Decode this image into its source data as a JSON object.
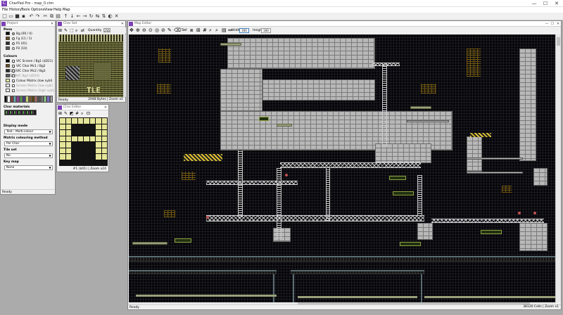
{
  "app": {
    "title": "CharPad Pro - map_0.ctm",
    "controls": [
      "—",
      "☐",
      "✕"
    ]
  },
  "menu": [
    "File",
    "History",
    "Tools",
    "Options",
    "View",
    "Help",
    "Map"
  ],
  "toolbar_icons": [
    "new-icon",
    "open-icon",
    "save-icon",
    "save-all-icon",
    "undo-icon",
    "redo-icon",
    "cut-icon",
    "copy-icon",
    "paste-icon",
    "shift-up-icon",
    "shift-down-icon",
    "shift-left-icon",
    "shift-right-icon",
    "rotate-icon",
    "mirror-icon",
    "flip-icon",
    "invert-icon",
    "clear-icon"
  ],
  "project": {
    "caption": "Project",
    "pens_title": "Pens",
    "pens": [
      {
        "label": "Bg (00 / 0)",
        "color": "#000000",
        "selected": true
      },
      {
        "label": "Fg (11 / 1)",
        "color": "#6b4a1a",
        "selected": false
      },
      {
        "label": "P1 (01)",
        "color": "#2a2a2a",
        "selected": false
      },
      {
        "label": "P2 (10)",
        "color": "#5a5a5a",
        "selected": false
      }
    ],
    "colours_title": "Colours",
    "colours": [
      {
        "label": "VIC Screen / Bg1 ($D21)",
        "color": "#000000",
        "checked": true
      },
      {
        "label": "VIC Char Mc1 / Bg2 ($D22)",
        "color": "#6b4a1a",
        "checked": true
      },
      {
        "label": "VIC Char Mc2 / Bg3 ($D23)",
        "color": "#2a2a2a",
        "checked": true
      },
      {
        "label": "VIC Bg4 ($D24)",
        "color": "#5a5a5a",
        "checked": false
      },
      {
        "label": "Colour Matrix (low nybl)",
        "color": "#e8e8a0",
        "checked": true
      },
      {
        "label": "Screen Matrix (low nybl)",
        "color": "#ffffff",
        "checked": false
      },
      {
        "label": "Screen Matrix (high nybl)",
        "color": "#ffffff",
        "checked": false
      }
    ],
    "palette": [
      "#000000",
      "#ffffff",
      "#883932",
      "#67b6bd",
      "#8b3f96",
      "#55a049",
      "#40318d",
      "#bfce72",
      "#8b5429",
      "#574200",
      "#b86962",
      "#505050",
      "#787878",
      "#94e089",
      "#7869c4",
      "#9f9f9f"
    ],
    "char_materials_title": "Char materials",
    "display_mode_label": "Display mode",
    "display_mode": "Text - Multi-colour",
    "matrix_label": "Matrix colouring method",
    "matrix_value": "Per Char",
    "tileset_label": "Tile set",
    "tileset_value": "No",
    "keymap_label": "Key map",
    "keymap_value": "None",
    "status": "Ready"
  },
  "charset": {
    "caption": "Char Set",
    "quantity_label": "Quantity",
    "quantity_value": "256",
    "status": "Ready",
    "status_right": "2048 Bytes | Zoom x1"
  },
  "char_editor": {
    "caption": "Char Editor",
    "status_right": "#1 ($01) | Zoom x24"
  },
  "map_editor": {
    "caption": "Map Editor",
    "width_label": "Width",
    "width_value": "160",
    "height_label": "Height",
    "height_value": "160",
    "status": "Ready",
    "status_right": "38120 Cells | Zoom x1"
  }
}
